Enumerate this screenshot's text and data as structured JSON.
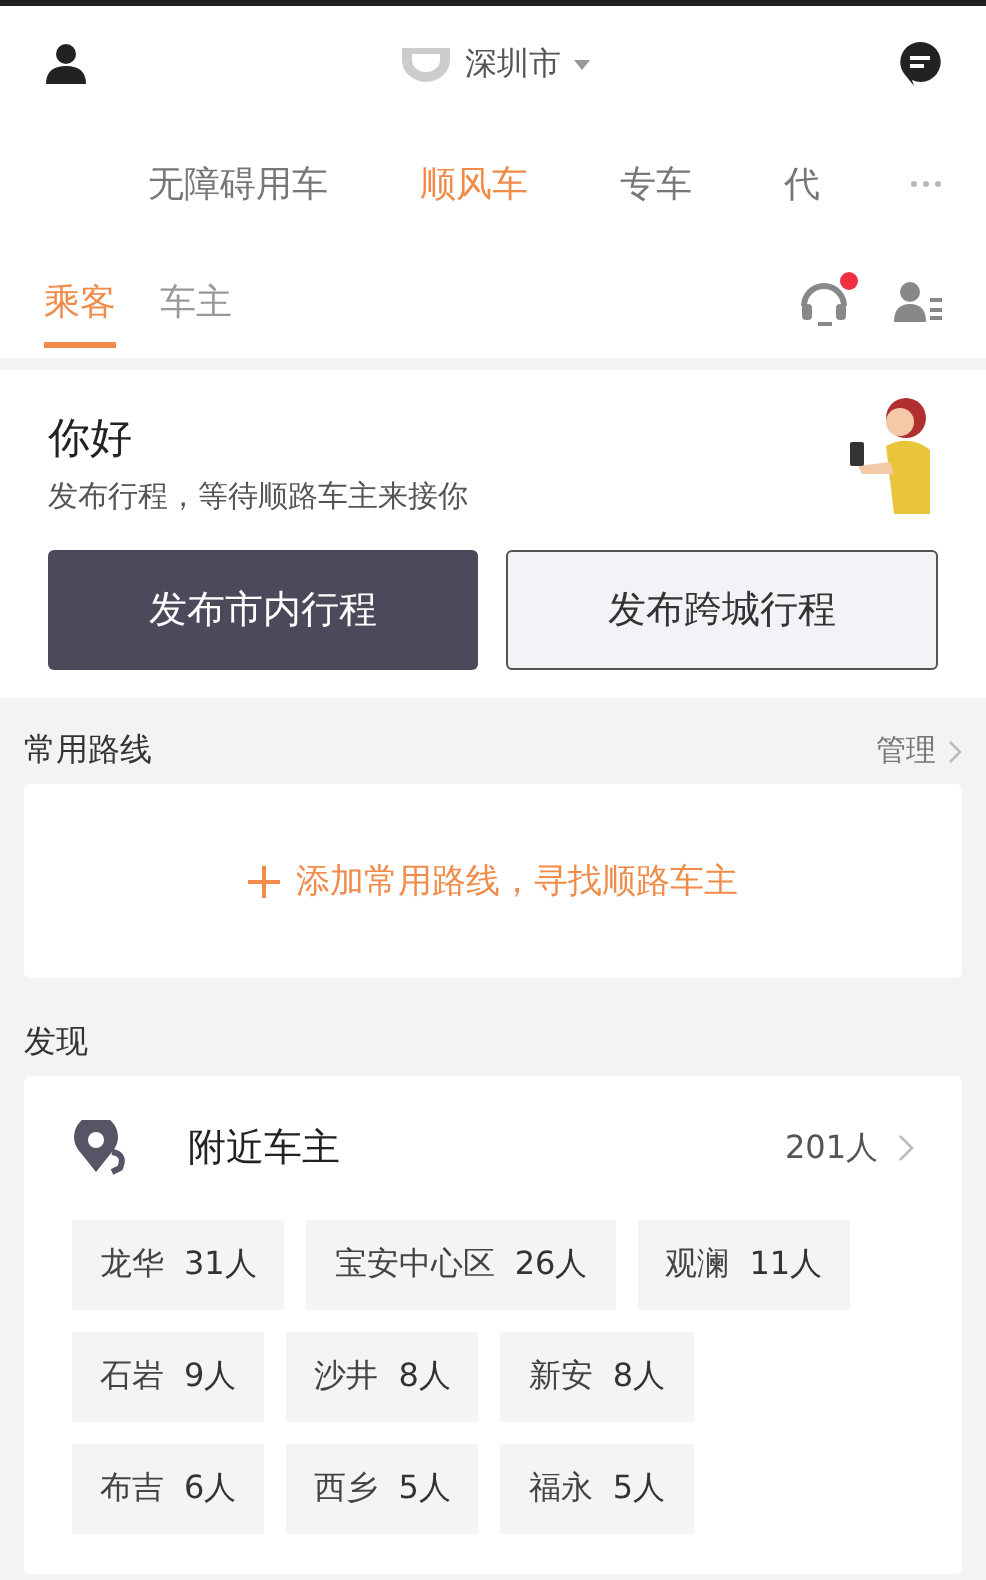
{
  "header": {
    "city": "深圳市"
  },
  "service_tabs": [
    {
      "label": "无障碍用车",
      "selected": false
    },
    {
      "label": "顺风车",
      "selected": true
    },
    {
      "label": "专车",
      "selected": false
    },
    {
      "label": "代",
      "selected": false
    }
  ],
  "role_tabs": [
    {
      "label": "乘客",
      "selected": true
    },
    {
      "label": "车主",
      "selected": false
    }
  ],
  "support": {
    "has_notification": true
  },
  "greeting": {
    "title": "你好",
    "subtitle": "发布行程，等待顺路车主来接你",
    "buttons": [
      {
        "label": "发布市内行程",
        "kind": "primary"
      },
      {
        "label": "发布跨城行程",
        "kind": "secondary"
      }
    ]
  },
  "routes": {
    "title": "常用路线",
    "manage": "管理",
    "add_label": "添加常用路线，寻找顺路车主"
  },
  "discover": {
    "title": "发现",
    "nearby": {
      "title": "附近车主",
      "count": "201人",
      "areas": [
        {
          "name": "龙华",
          "count": "31人"
        },
        {
          "name": "宝安中心区",
          "count": "26人"
        },
        {
          "name": "观澜",
          "count": "11人"
        },
        {
          "name": "石岩",
          "count": "9人"
        },
        {
          "name": "沙井",
          "count": "8人"
        },
        {
          "name": "新安",
          "count": "8人"
        },
        {
          "name": "布吉",
          "count": "6人"
        },
        {
          "name": "西乡",
          "count": "5人"
        },
        {
          "name": "福永",
          "count": "5人"
        }
      ]
    }
  }
}
